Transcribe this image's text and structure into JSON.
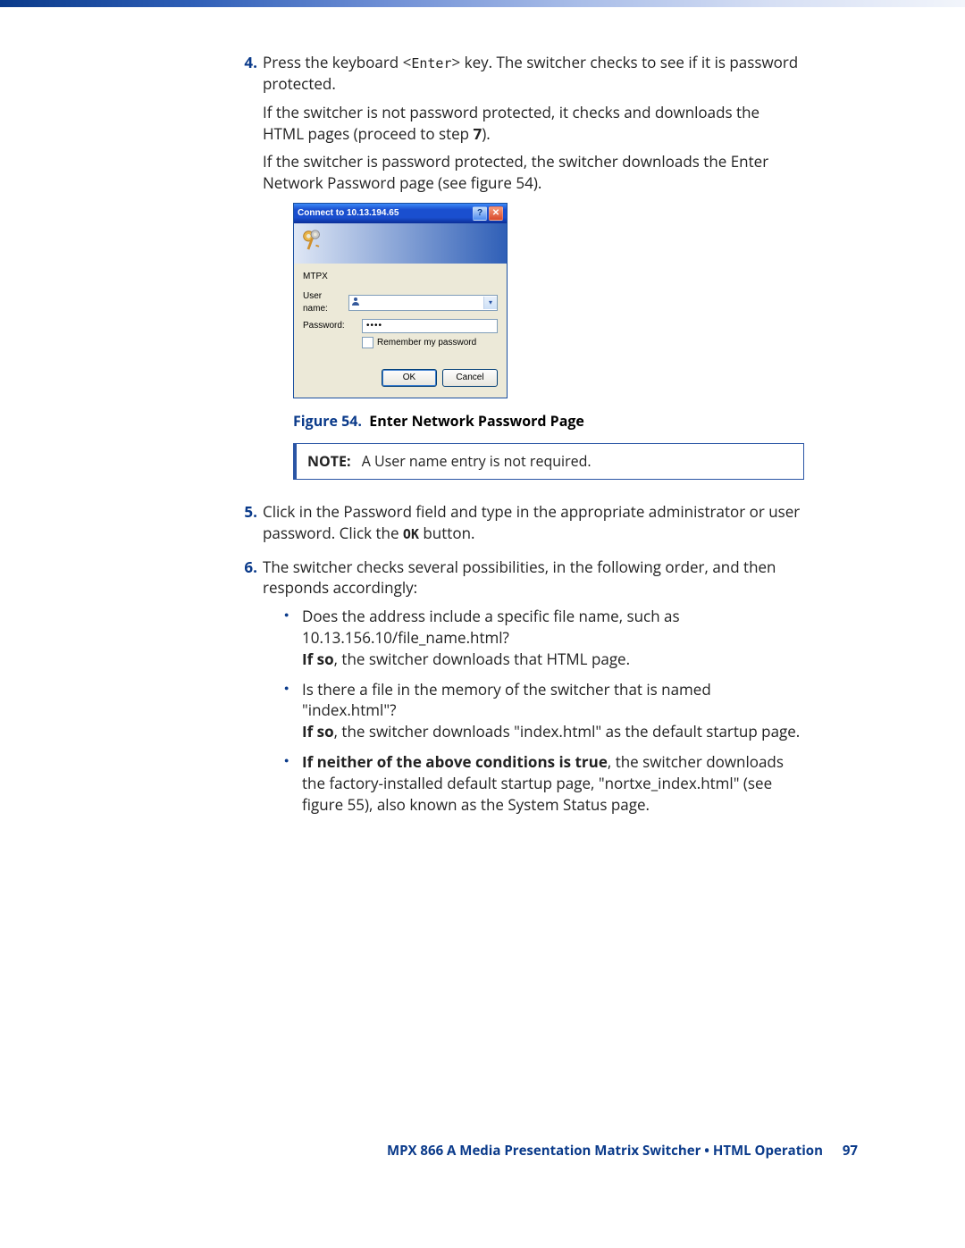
{
  "steps": {
    "s4": {
      "num": "4.",
      "p1a": "Press the keyboard <",
      "p1key": "Enter",
      "p1b": "> key. The switcher checks to see if it is password protected.",
      "p2a": "If the switcher is not password protected, it checks and downloads the HTML pages (proceed to step ",
      "p2bold": "7",
      "p2b": ").",
      "p3": "If the switcher is password protected, the switcher downloads the Enter Network Password page (see figure 54)."
    },
    "s5": {
      "num": "5.",
      "p1a": "Click in the Password field and type in the appropriate administrator or user password. Click the ",
      "p1bold": "OK",
      "p1b": " button."
    },
    "s6": {
      "num": "6.",
      "p1": "The switcher checks several possibilities, in the following order, and then responds accordingly:",
      "b1a": "Does the address include a specific file name, such as 10.13.156.10/file_name.html? ",
      "b1bold": "If so",
      "b1b": ", the switcher downloads that HTML page.",
      "b2a": "Is there a file in the memory of the switcher that is named \"index.html\"? ",
      "b2bold": "If so",
      "b2b": ", the switcher downloads \"index.html\" as the default startup page.",
      "b3bold": "If neither of the above conditions is true",
      "b3a": ", the switcher downloads the factory-installed default startup page, \"nortxe_index.html\" (see figure 55), also known as the System Status page."
    }
  },
  "dialog": {
    "title": "Connect to 10.13.194.65",
    "section": "MTPX",
    "username_label": "User name:",
    "password_label": "Password:",
    "password_value": "••••",
    "remember": "Remember my password",
    "ok": "OK",
    "cancel": "Cancel"
  },
  "figure": {
    "label": "Figure 54.",
    "caption": "Enter Network Password Page"
  },
  "note": {
    "label": "NOTE:",
    "text": "A User name entry is not required."
  },
  "footer": {
    "text": "MPX 866 A Media Presentation Matrix Switcher • HTML Operation",
    "page": "97"
  }
}
